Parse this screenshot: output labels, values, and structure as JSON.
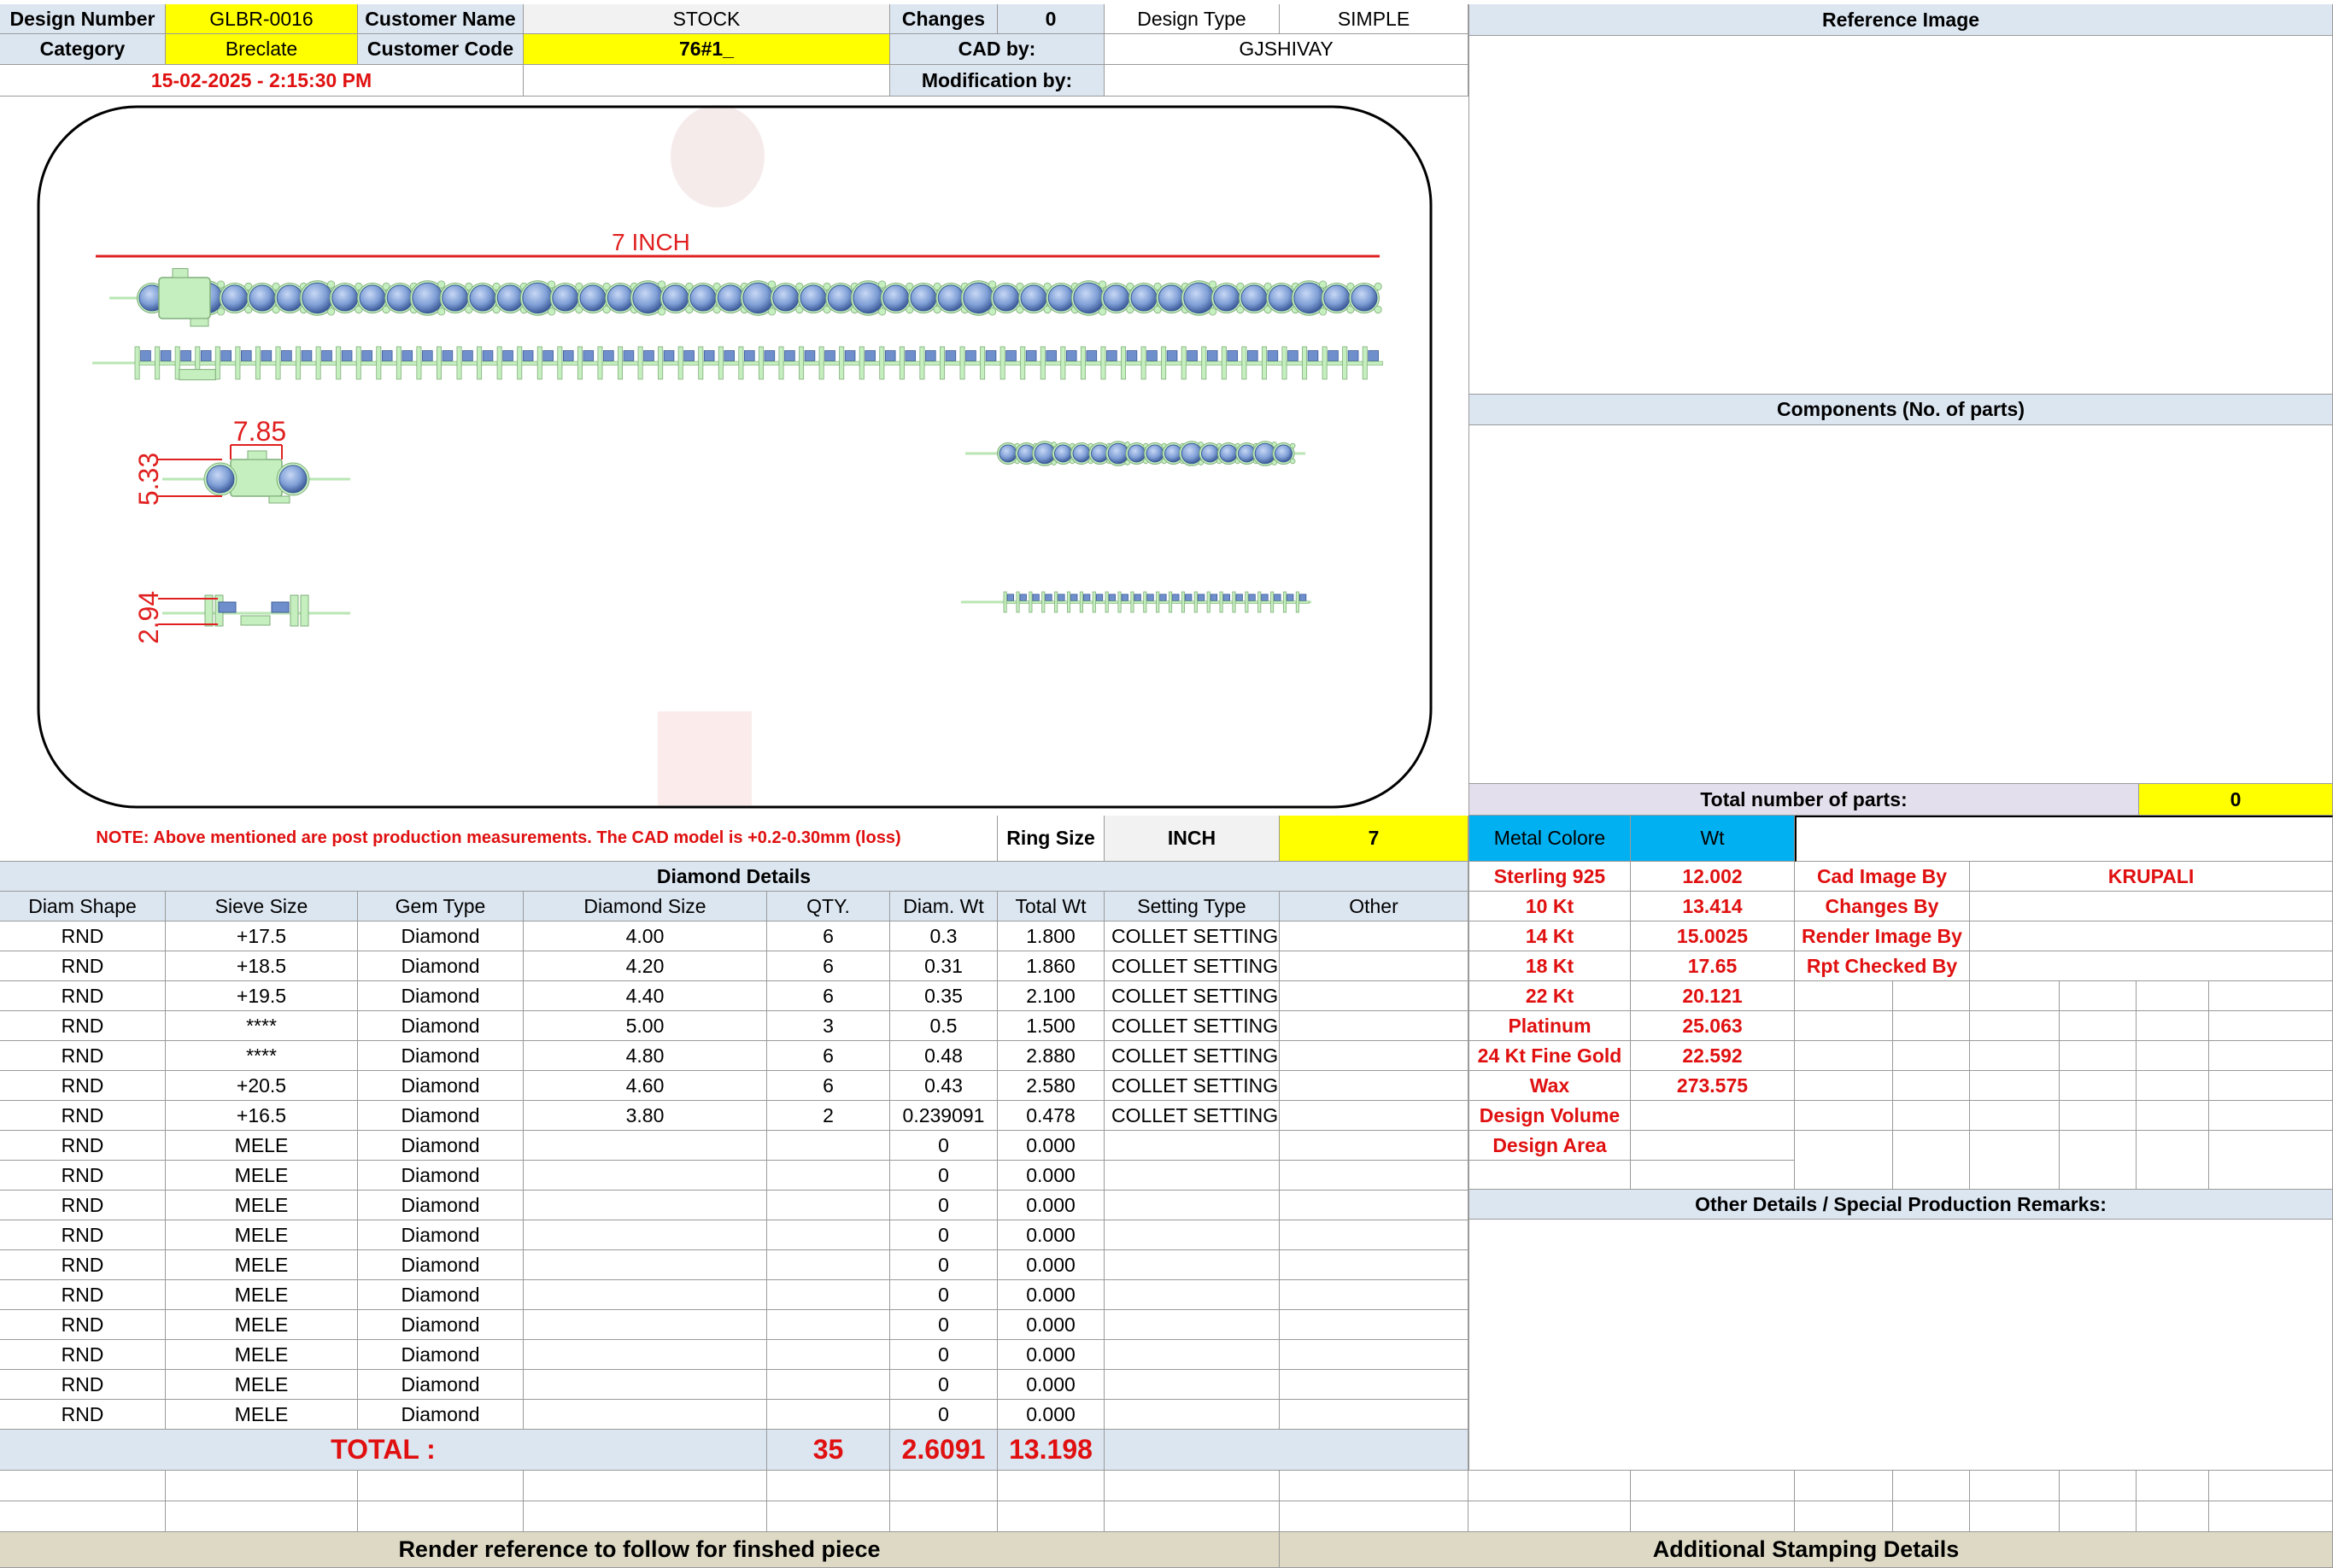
{
  "header": {
    "design_number_label": "Design Number",
    "design_number": "GLBR-0016",
    "customer_name_label": "Customer Name",
    "customer_name": "STOCK",
    "changes_label": "Changes",
    "changes": "0",
    "design_type_label": "Design Type",
    "design_type": "SIMPLE",
    "category_label": "Category",
    "category": "Breclate",
    "customer_code_label": "Customer Code",
    "customer_code": "76#1_",
    "cad_by_label": "CAD by:",
    "cad_by": "GJSHIVAY",
    "timestamp": "15-02-2025 - 2:15:30 PM",
    "modification_by_label": "Modification by:"
  },
  "drawing": {
    "length_label": "7 INCH",
    "width_label": "7.85",
    "height_label": "5.33",
    "depth_label": "2.94"
  },
  "right_panel": {
    "reference_image_label": "Reference Image",
    "components_label": "Components (No. of parts)",
    "total_parts_label": "Total number of parts:",
    "total_parts": "0",
    "other_details_label": "Other Details / Special Production Remarks:"
  },
  "note": {
    "text": "NOTE: Above mentioned are post production measurements. The CAD model is +0.2-0.30mm (loss)",
    "ring_size_label": "Ring Size",
    "ring_size_unit": "INCH",
    "ring_size": "7"
  },
  "metal": {
    "header_label": "Metal Colore",
    "wt_label": "Wt",
    "rows": [
      {
        "name": "Sterling 925",
        "wt": "12.002"
      },
      {
        "name": "10 Kt",
        "wt": "13.414"
      },
      {
        "name": "14 Kt",
        "wt": "15.0025"
      },
      {
        "name": "18 Kt",
        "wt": "17.65"
      },
      {
        "name": "22 Kt",
        "wt": "20.121"
      },
      {
        "name": "Platinum",
        "wt": "25.063"
      },
      {
        "name": "24 Kt Fine Gold",
        "wt": "22.592"
      },
      {
        "name": "Wax",
        "wt": "273.575"
      },
      {
        "name": "Design Volume",
        "wt": ""
      },
      {
        "name": "Design Area",
        "wt": ""
      }
    ]
  },
  "credits": {
    "rows": [
      {
        "label": "Cad Image By",
        "value": "KRUPALI"
      },
      {
        "label": "Changes By",
        "value": ""
      },
      {
        "label": "Render Image By",
        "value": ""
      },
      {
        "label": "Rpt Checked By",
        "value": ""
      }
    ]
  },
  "diamond": {
    "title": "Diamond Details",
    "columns": [
      "Diam Shape",
      "Sieve Size",
      "Gem Type",
      "Diamond Size",
      "QTY.",
      "Diam. Wt",
      "Total Wt",
      "Setting Type",
      "Other"
    ],
    "rows": [
      [
        "RND",
        "+17.5",
        "Diamond",
        "4.00",
        "6",
        "0.3",
        "1.800",
        "COLLET SETTING",
        ""
      ],
      [
        "RND",
        "+18.5",
        "Diamond",
        "4.20",
        "6",
        "0.31",
        "1.860",
        "COLLET SETTING",
        ""
      ],
      [
        "RND",
        "+19.5",
        "Diamond",
        "4.40",
        "6",
        "0.35",
        "2.100",
        "COLLET SETTING",
        ""
      ],
      [
        "RND",
        "****",
        "Diamond",
        "5.00",
        "3",
        "0.5",
        "1.500",
        "COLLET SETTING",
        ""
      ],
      [
        "RND",
        "****",
        "Diamond",
        "4.80",
        "6",
        "0.48",
        "2.880",
        "COLLET SETTING",
        ""
      ],
      [
        "RND",
        "+20.5",
        "Diamond",
        "4.60",
        "6",
        "0.43",
        "2.580",
        "COLLET SETTING",
        ""
      ],
      [
        "RND",
        "+16.5",
        "Diamond",
        "3.80",
        "2",
        "0.239091",
        "0.478",
        "COLLET SETTING",
        ""
      ],
      [
        "RND",
        "MELE",
        "Diamond",
        "",
        "",
        "0",
        "0.000",
        "",
        ""
      ],
      [
        "RND",
        "MELE",
        "Diamond",
        "",
        "",
        "0",
        "0.000",
        "",
        ""
      ],
      [
        "RND",
        "MELE",
        "Diamond",
        "",
        "",
        "0",
        "0.000",
        "",
        ""
      ],
      [
        "RND",
        "MELE",
        "Diamond",
        "",
        "",
        "0",
        "0.000",
        "",
        ""
      ],
      [
        "RND",
        "MELE",
        "Diamond",
        "",
        "",
        "0",
        "0.000",
        "",
        ""
      ],
      [
        "RND",
        "MELE",
        "Diamond",
        "",
        "",
        "0",
        "0.000",
        "",
        ""
      ],
      [
        "RND",
        "MELE",
        "Diamond",
        "",
        "",
        "0",
        "0.000",
        "",
        ""
      ],
      [
        "RND",
        "MELE",
        "Diamond",
        "",
        "",
        "0",
        "0.000",
        "",
        ""
      ],
      [
        "RND",
        "MELE",
        "Diamond",
        "",
        "",
        "0",
        "0.000",
        "",
        ""
      ],
      [
        "RND",
        "MELE",
        "Diamond",
        "",
        "",
        "0",
        "0.000",
        "",
        ""
      ]
    ],
    "total_label": "TOTAL :",
    "total_qty": "35",
    "total_diam_wt": "2.6091",
    "total_wt": "13.198"
  },
  "footer": {
    "render_reference": "Render reference to follow for finshed piece",
    "stamping": "Additional Stamping Details"
  },
  "colors": {
    "label_blue": "#dce6f1",
    "highlight_yellow": "#ffff00",
    "metal_header": "#00b0f0",
    "accent_red": "#e01010",
    "footer_beige": "#ddd9c4",
    "stone_blue": "#7f9fd6",
    "metal_green": "#c6efc0"
  }
}
